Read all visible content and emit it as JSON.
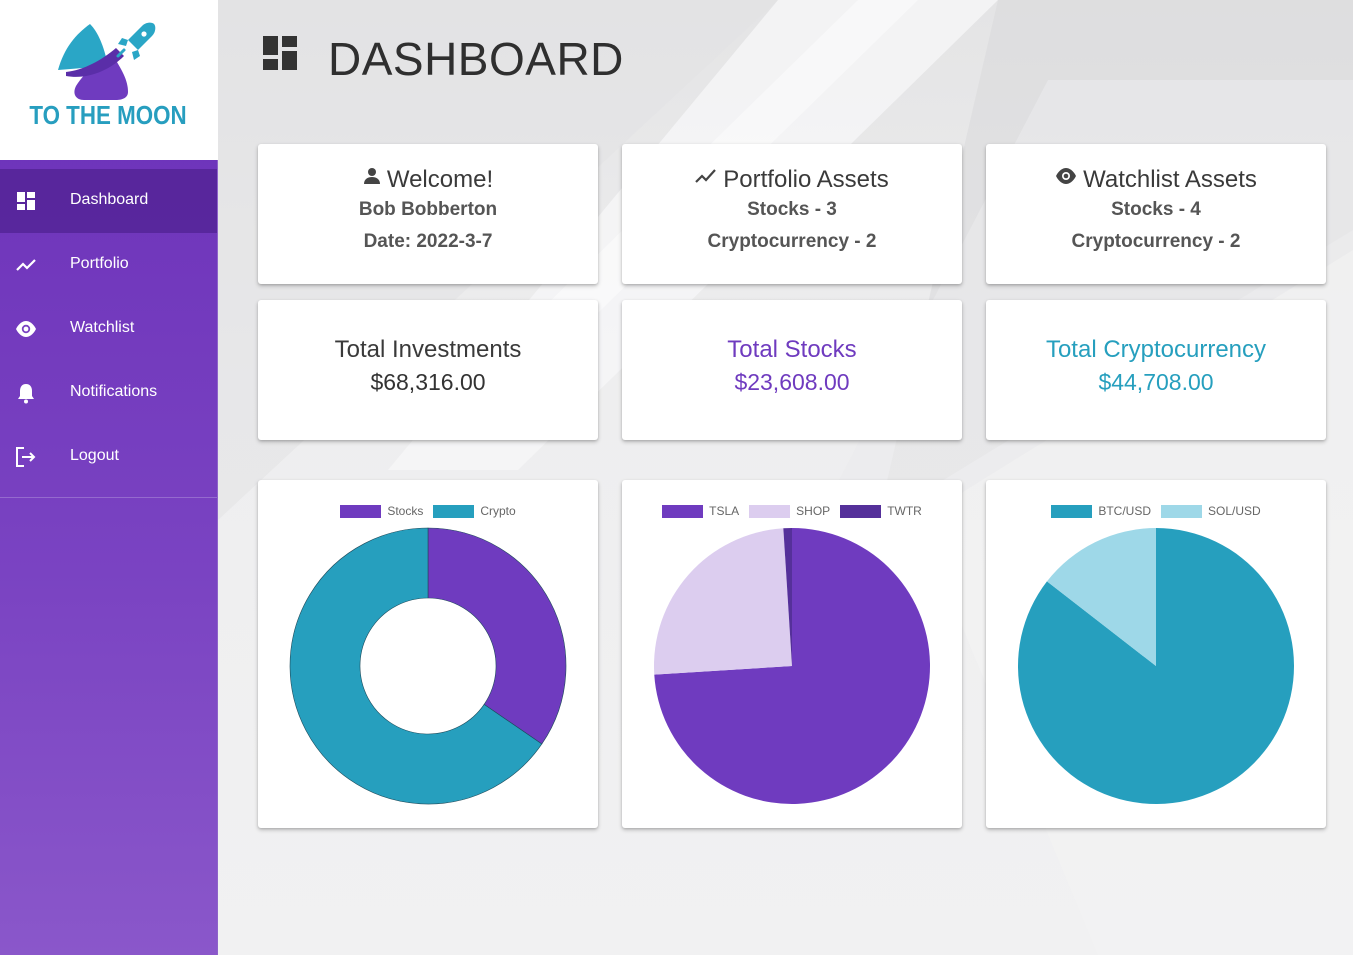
{
  "app": {
    "logo_text": "TO THE MOON",
    "colors": {
      "purple": "#6f3bbf",
      "teal": "#269fbe",
      "light_purple": "#dccdef",
      "dark_purple": "#55309a",
      "light_teal": "#9ed8e8"
    }
  },
  "sidebar": {
    "items": [
      {
        "label": "Dashboard",
        "icon": "dashboard-icon",
        "active": true
      },
      {
        "label": "Portfolio",
        "icon": "trending-line-icon",
        "active": false
      },
      {
        "label": "Watchlist",
        "icon": "eye-icon",
        "active": false
      },
      {
        "label": "Notifications",
        "icon": "bell-icon",
        "active": false
      },
      {
        "label": "Logout",
        "icon": "logout-icon",
        "active": false
      }
    ]
  },
  "header": {
    "title": "DASHBOARD",
    "icon": "dashboard-icon"
  },
  "cards": {
    "welcome": {
      "title": "Welcome!",
      "icon": "person-icon",
      "name": "Bob Bobberton",
      "date": "Date: 2022-3-7"
    },
    "portfolio": {
      "title": "Portfolio Assets",
      "icon": "trending-line-icon",
      "stocks": "Stocks - 3",
      "crypto": "Cryptocurrency - 2"
    },
    "watchlist": {
      "title": "Watchlist Assets",
      "icon": "eye-icon",
      "stocks": "Stocks - 4",
      "crypto": "Cryptocurrency - 2"
    },
    "total_investments": {
      "title": "Total Investments",
      "value": "$68,316.00"
    },
    "total_stocks": {
      "title": "Total Stocks",
      "value": "$23,608.00"
    },
    "total_crypto": {
      "title": "Total Cryptocurrency",
      "value": "$44,708.00"
    }
  },
  "chart_data": [
    {
      "type": "pie",
      "variant": "doughnut",
      "categories": [
        "Stocks",
        "Crypto"
      ],
      "values": [
        23608,
        44708
      ],
      "colors": [
        "#6f3bbf",
        "#269fbe"
      ],
      "legend": "top"
    },
    {
      "type": "pie",
      "categories": [
        "TSLA",
        "SHOP",
        "TWTR"
      ],
      "values": [
        74,
        25,
        1
      ],
      "colors": [
        "#6f3bbf",
        "#dccdef",
        "#55309a"
      ],
      "legend": "top"
    },
    {
      "type": "pie",
      "categories": [
        "BTC/USD",
        "SOL/USD"
      ],
      "values": [
        85.5,
        14.5
      ],
      "colors": [
        "#269fbe",
        "#9ed8e8"
      ],
      "legend": "top"
    }
  ]
}
